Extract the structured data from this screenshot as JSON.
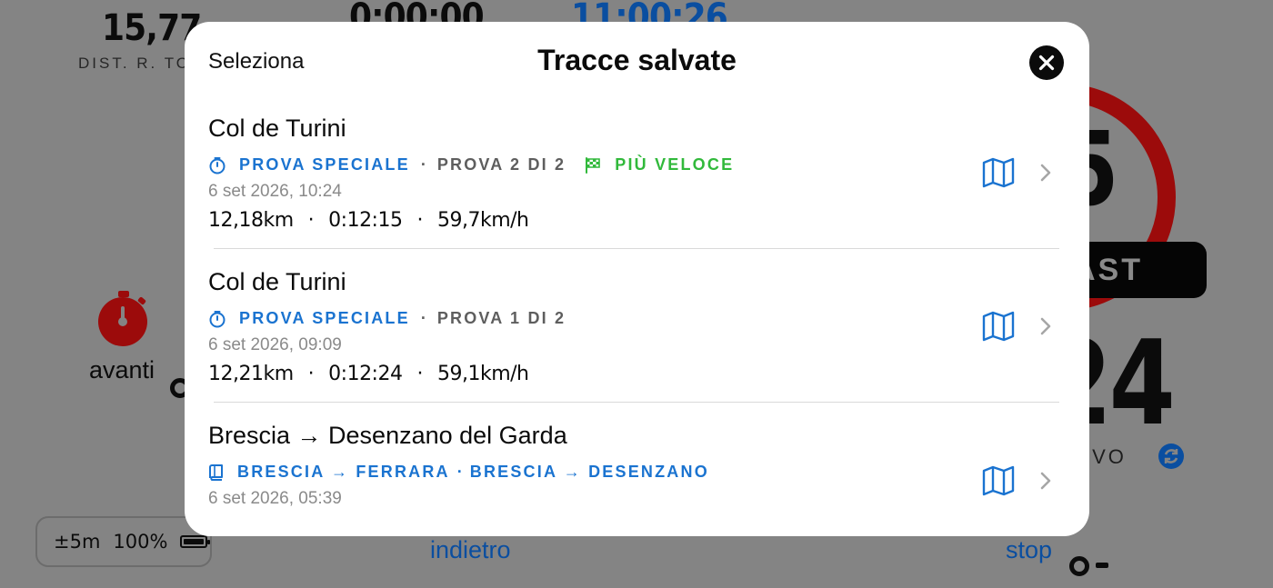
{
  "background": {
    "dist_value": "15,77",
    "dist_label": "DIST. R. TO",
    "time_value": "0:00:00",
    "clock_value": "11:00:26",
    "speed_limit": "5",
    "status_pill": "AST",
    "big_number": "24",
    "big_number_label": "IVO",
    "stopwatch_label": "avanti",
    "back_label": "indietro",
    "stop_label": "stop",
    "gps_accuracy": "±5m",
    "battery_percent": "100%"
  },
  "modal": {
    "select_label": "Seleziona",
    "title": "Tracce salvate",
    "close_icon": "close-icon"
  },
  "tracks": [
    {
      "name": "Col de Turini",
      "kind_label": "PROVA SPECIALE",
      "stage_label": "PROVA 2 DI 2",
      "badge_label": "PIÙ VELOCE",
      "date": "6 set 2026, 10:24",
      "distance": "12,18km",
      "duration": "0:12:15",
      "avg_speed": "59,7km/h"
    },
    {
      "name": "Col de Turini",
      "kind_label": "PROVA SPECIALE",
      "stage_label": "PROVA 1 DI 2",
      "date": "6 set 2026, 09:09",
      "distance": "12,21km",
      "duration": "0:12:24",
      "avg_speed": "59,1km/h"
    },
    {
      "name": "Brescia → Desenzano del Garda",
      "roadbook_label": "BRESCIA → FERRARA",
      "route_label": "BRESCIA → DESENZANO",
      "date": "6 set 2026, 05:39"
    }
  ],
  "separators": {
    "dot": "·"
  },
  "colors": {
    "accent_blue": "#1a73d0",
    "fastest_green": "#31b93b",
    "overlay_grey": "#848484",
    "speed_red": "#9c0b0b"
  }
}
